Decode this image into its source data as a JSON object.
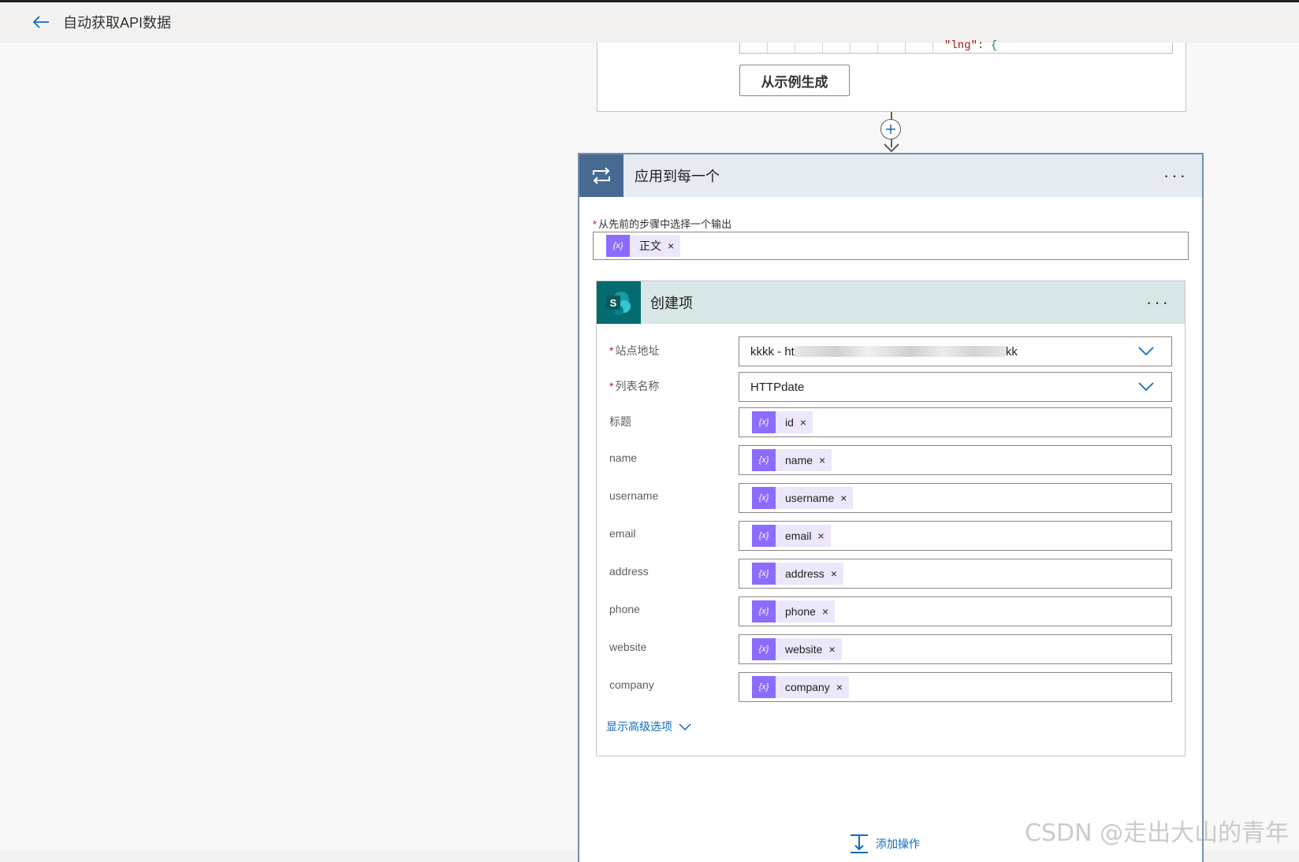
{
  "topbar": {
    "title": "自动获取API数据"
  },
  "prev_card": {
    "code_key": "\"lng\"",
    "code_sep": ": ",
    "code_brace": "{",
    "generate_button": "从示例生成"
  },
  "apply_each": {
    "title": "应用到每一个",
    "output_label": "从先前的步骤中选择一个输出",
    "output_token": "正文"
  },
  "create_item": {
    "title": "创建项",
    "site_label": "站点地址",
    "site_value_prefix": "kkkk - ht",
    "site_value_suffix": "kk",
    "list_label": "列表名称",
    "list_value": "HTTPdate",
    "fields": [
      {
        "label": "标题",
        "token": "id"
      },
      {
        "label": "name",
        "token": "name"
      },
      {
        "label": "username",
        "token": "username"
      },
      {
        "label": "email",
        "token": "email"
      },
      {
        "label": "address",
        "token": "address"
      },
      {
        "label": "phone",
        "token": "phone"
      },
      {
        "label": "website",
        "token": "website"
      },
      {
        "label": "company",
        "token": "company"
      }
    ],
    "advanced_link": "显示高级选项"
  },
  "add_action": "添加操作",
  "watermark": "CSDN @走出大山的青年",
  "colors": {
    "token_icon": "#8c6cff",
    "loop_header_icon": "#486991",
    "sharepoint": "#036c70",
    "link": "#0f6cbd"
  }
}
